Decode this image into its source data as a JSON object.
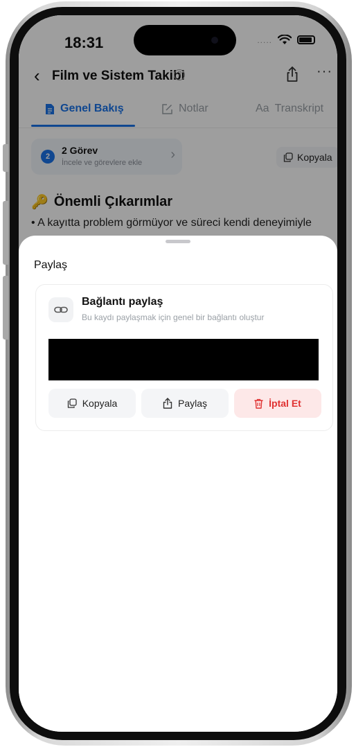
{
  "status_bar": {
    "time": "18:31",
    "signal": "....."
  },
  "nav": {
    "title": "Film ve Sistem Takibi",
    "info": "?",
    "more": "···"
  },
  "tabs": [
    {
      "label": "Genel Bakış",
      "active": true,
      "icon": "document-icon"
    },
    {
      "label": "Notlar",
      "active": false,
      "icon": "edit-icon"
    },
    {
      "label": "Transkript",
      "active": false,
      "icon_text": "Aa"
    }
  ],
  "tasks": {
    "count": "2",
    "title": "2 Görev",
    "subtitle": "İncele ve görevlere ekle",
    "chevron": "›"
  },
  "copy_top_label": "Kopyala",
  "key_takeaways": {
    "icon": "🔑",
    "title": "Önemli Çıkarımlar",
    "bullet": "• A kayıtta problem görmüyor ve süreci kendi deneyimiyle"
  },
  "share_sheet": {
    "title": "Paylaş",
    "link_title": "Bağlantı paylaş",
    "link_subtitle": "Bu kaydı paylaşmak için genel bir bağlantı oluştur",
    "buttons": {
      "copy": "Kopyala",
      "share": "Paylaş",
      "cancel": "İptal Et"
    }
  },
  "colors": {
    "accent": "#1a73e8",
    "danger": "#e03131",
    "dim_overlay": "rgba(0,0,0,0.38)"
  }
}
